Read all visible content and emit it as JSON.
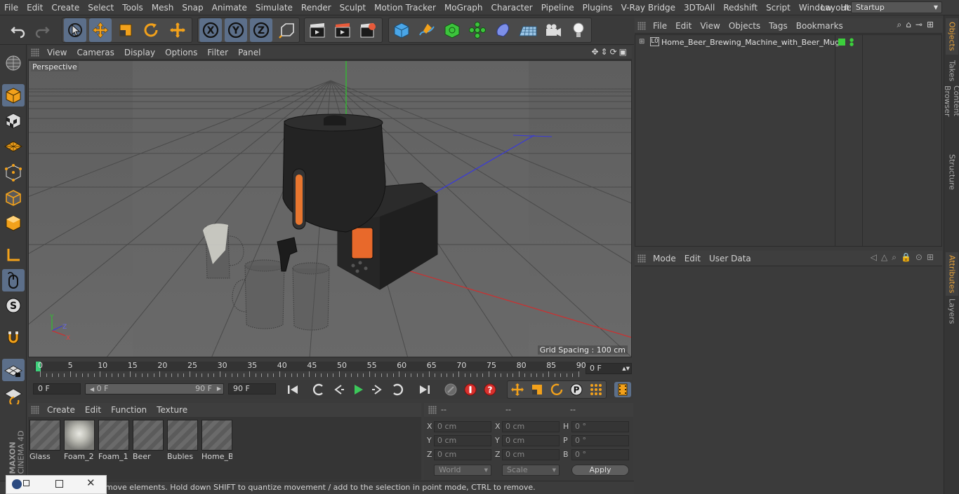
{
  "menubar": {
    "items": [
      "File",
      "Edit",
      "Create",
      "Select",
      "Tools",
      "Mesh",
      "Snap",
      "Animate",
      "Simulate",
      "Render",
      "Sculpt",
      "Motion Tracker",
      "MoGraph",
      "Character",
      "Pipeline",
      "Plugins",
      "V-Ray Bridge",
      "3DToAll",
      "Redshift",
      "Script",
      "Window",
      "Help"
    ],
    "layout_label": "Layout:",
    "layout_value": "Startup"
  },
  "viewport": {
    "menu": [
      "View",
      "Cameras",
      "Display",
      "Options",
      "Filter",
      "Panel"
    ],
    "label": "Perspective",
    "grid_spacing": "Grid Spacing : 100 cm",
    "axis_labels": [
      "Y",
      "Z",
      "X"
    ]
  },
  "timeline": {
    "ticks": [
      "0",
      "5",
      "10",
      "15",
      "20",
      "25",
      "30",
      "35",
      "40",
      "45",
      "50",
      "55",
      "60",
      "65",
      "70",
      "75",
      "80",
      "85",
      "90"
    ],
    "current_frame": "0 F",
    "start": "0 F",
    "range_start": "0 F",
    "range_end": "90 F",
    "end": "90 F"
  },
  "materials": {
    "menu": [
      "Create",
      "Edit",
      "Function",
      "Texture"
    ],
    "items": [
      "Glass",
      "Foam_2",
      "Foam_1",
      "Beer",
      "Bubles",
      "Home_B"
    ]
  },
  "coords": {
    "headers": [
      "--",
      "--",
      "--"
    ],
    "rows": [
      {
        "l1": "X",
        "v1": "0 cm",
        "l2": "X",
        "v2": "0 cm",
        "l3": "H",
        "v3": "0 °"
      },
      {
        "l1": "Y",
        "v1": "0 cm",
        "l2": "Y",
        "v2": "0 cm",
        "l3": "P",
        "v3": "0 °"
      },
      {
        "l1": "Z",
        "v1": "0 cm",
        "l2": "Z",
        "v2": "0 cm",
        "l3": "B",
        "v3": "0 °"
      }
    ],
    "world": "World",
    "scale": "Scale",
    "apply": "Apply"
  },
  "objects": {
    "menu": [
      "File",
      "Edit",
      "View",
      "Objects",
      "Tags",
      "Bookmarks"
    ],
    "items": [
      {
        "name": "Home_Beer_Brewing_Machine_with_Beer_Mugs",
        "tag_color": "#3ccf3c"
      }
    ]
  },
  "attributes": {
    "menu": [
      "Mode",
      "Edit",
      "User Data"
    ]
  },
  "side_tabs": [
    "Objects",
    "Takes",
    "Content Browser",
    "Structure",
    "Attributes",
    "Layers"
  ],
  "status": "move elements. Hold down SHIFT to quantize movement / add to the selection in point mode, CTRL to remove.",
  "brand": {
    "maxon": "MAXON",
    "cinema": "CINEMA 4D"
  },
  "colors": {
    "accent": "#5c6f8a",
    "active_tab": "#e8a33b",
    "x_axis": "#c83232",
    "y_axis": "#32c832",
    "z_axis": "#3a3ad8"
  }
}
